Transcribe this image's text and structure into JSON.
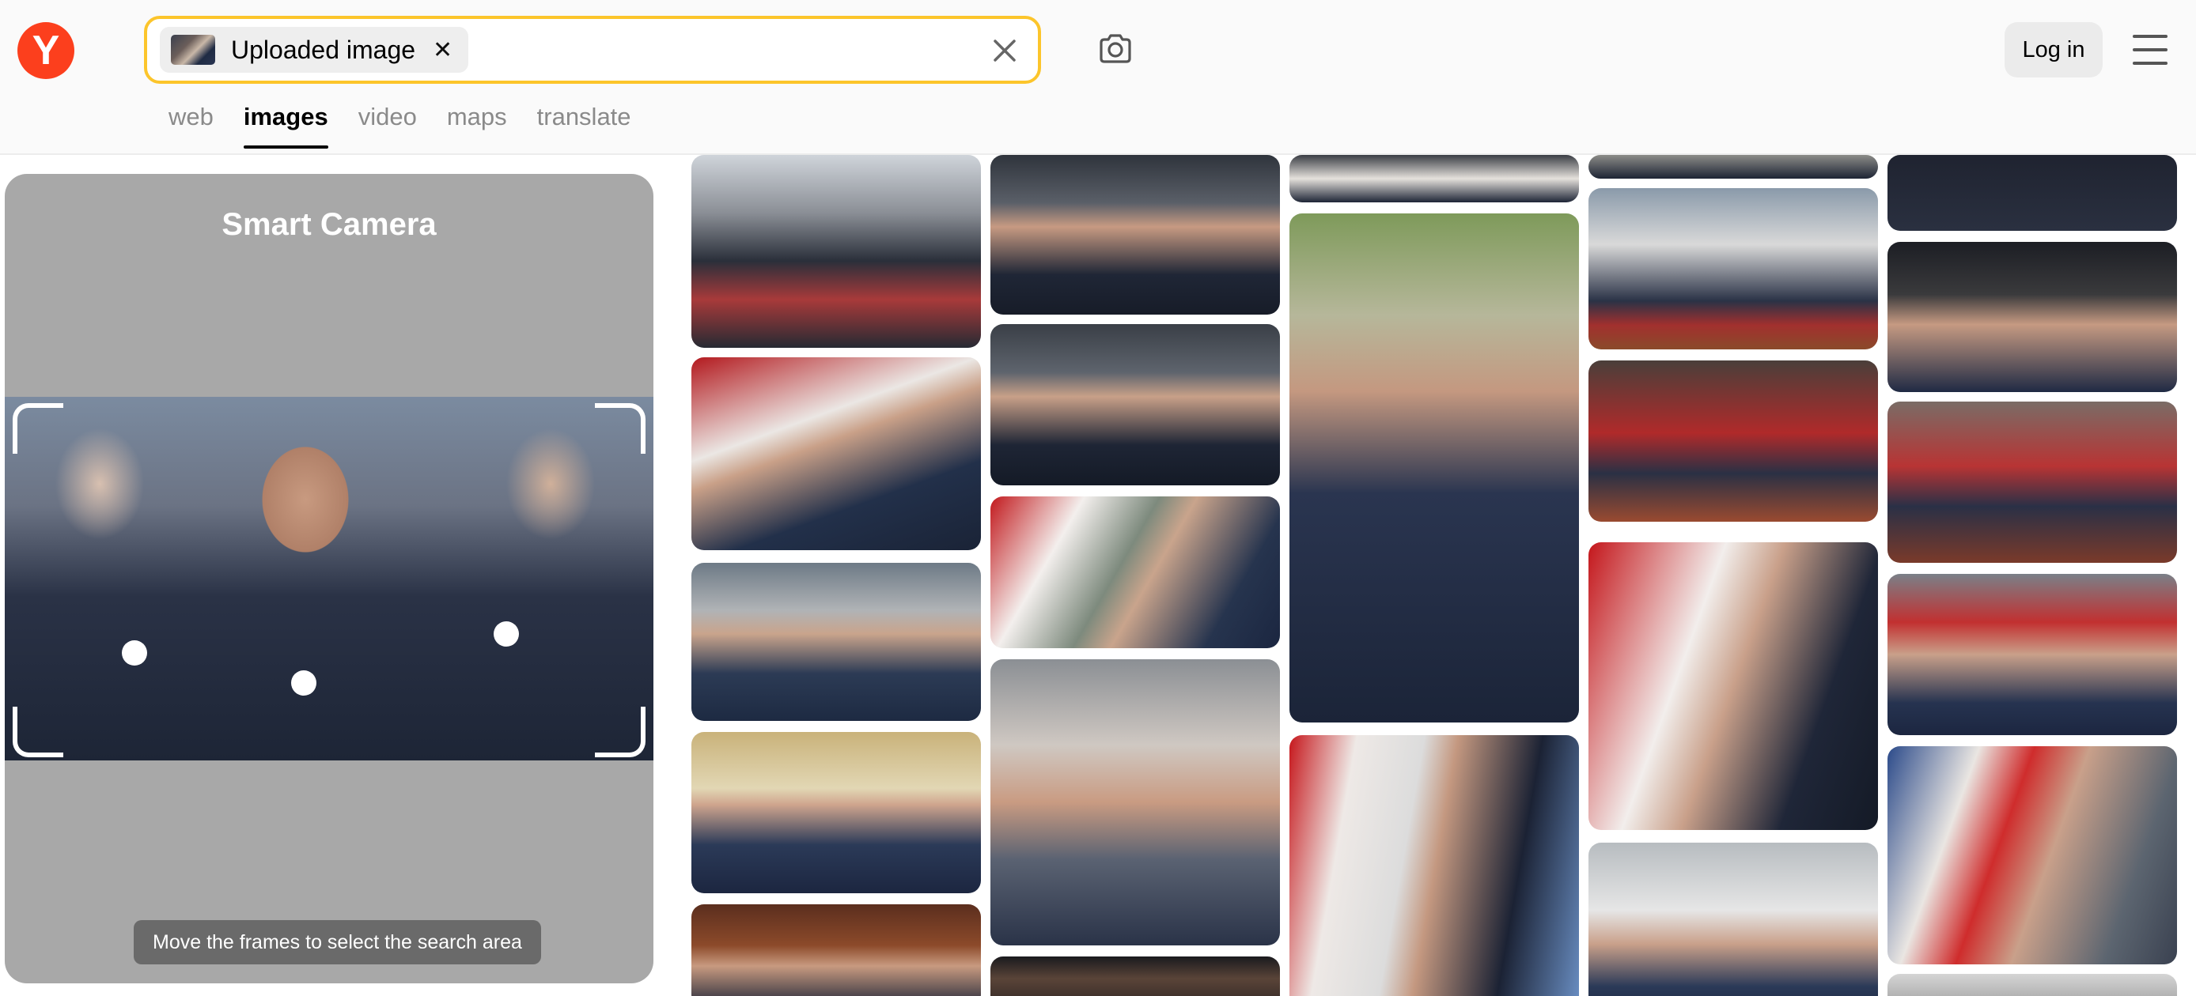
{
  "header": {
    "logo_letter": "Y",
    "search": {
      "chip_label": "Uploaded image",
      "chip_close": "✕"
    },
    "login_label": "Log in",
    "tabs": [
      {
        "label": "web",
        "active": false
      },
      {
        "label": "images",
        "active": true
      },
      {
        "label": "video",
        "active": false
      },
      {
        "label": "maps",
        "active": false
      },
      {
        "label": "translate",
        "active": false
      }
    ]
  },
  "smart_camera": {
    "title": "Smart Camera",
    "hint": "Move the frames to select the search area"
  },
  "colors": {
    "brand_red": "#fc3f1d",
    "search_border": "#fcc52b",
    "panel_bg": "#a8a8a8"
  },
  "results": {
    "tile_count": 24
  }
}
